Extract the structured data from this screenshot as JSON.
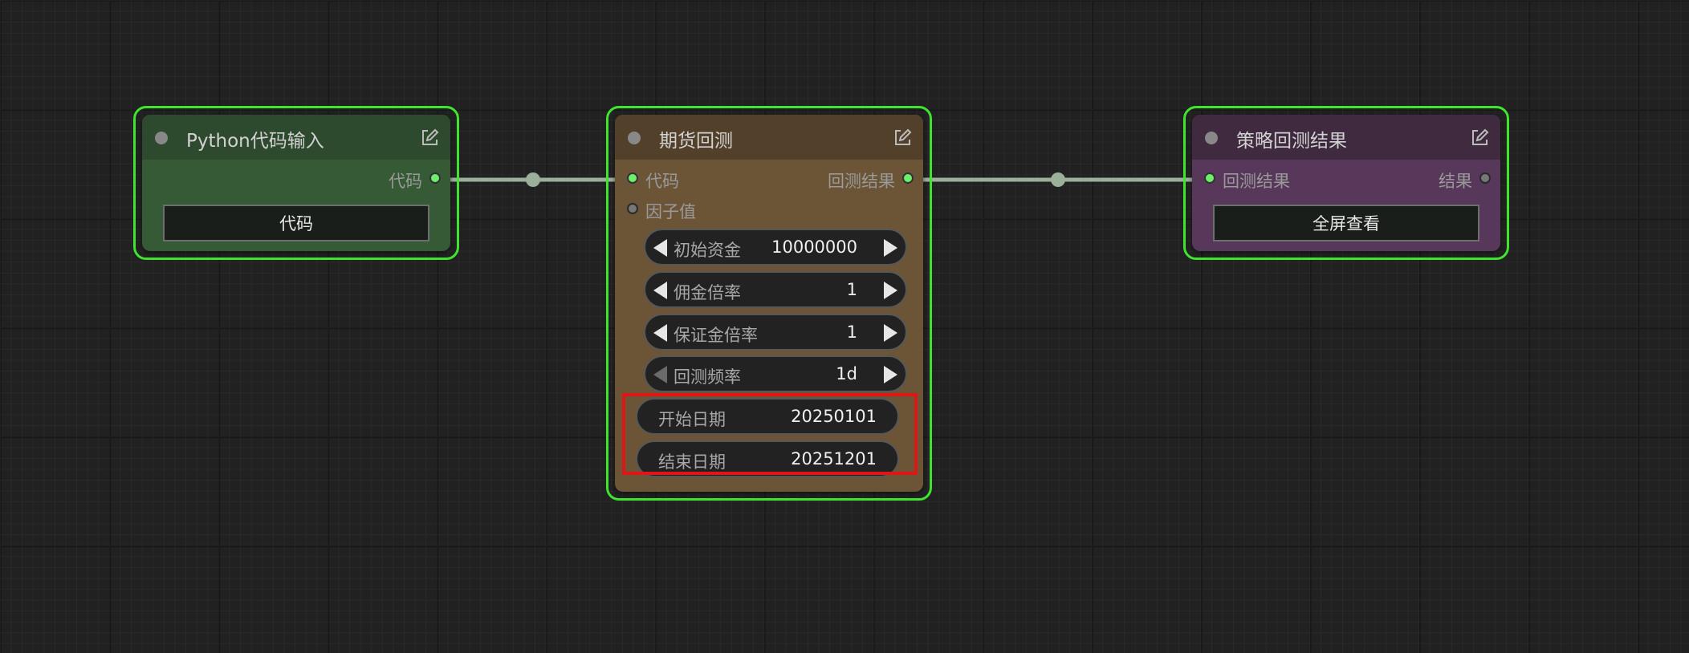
{
  "nodes": {
    "python_input": {
      "title": "Python代码输入",
      "outputs": [
        "代码"
      ],
      "button_label": "代码",
      "colors": {
        "header": "#2e4a2e",
        "body": "#355a35"
      }
    },
    "futures_backtest": {
      "title": "期货回测",
      "inputs": [
        "代码",
        "因子值"
      ],
      "outputs": [
        "回测结果"
      ],
      "widgets": [
        {
          "label": "初始资金",
          "value": "10000000"
        },
        {
          "label": "佣金倍率",
          "value": "1"
        },
        {
          "label": "保证金倍率",
          "value": "1"
        },
        {
          "label": "回测频率",
          "value": "1d"
        }
      ],
      "text_widgets": [
        {
          "label": "开始日期",
          "value": "20250101"
        },
        {
          "label": "结束日期",
          "value": "20251201"
        }
      ],
      "colors": {
        "header": "#53402a",
        "body": "#6b5536"
      }
    },
    "strategy_result": {
      "title": "策略回测结果",
      "inputs": [
        "回测结果"
      ],
      "outputs": [
        "结果"
      ],
      "button_label": "全屏查看",
      "colors": {
        "header": "#3f2a3f",
        "body": "#57375a"
      }
    }
  },
  "colors": {
    "selection_outline": "#3ee42e",
    "highlight": "#e01515",
    "link": "#9ab09a",
    "canvas": "#212121"
  }
}
